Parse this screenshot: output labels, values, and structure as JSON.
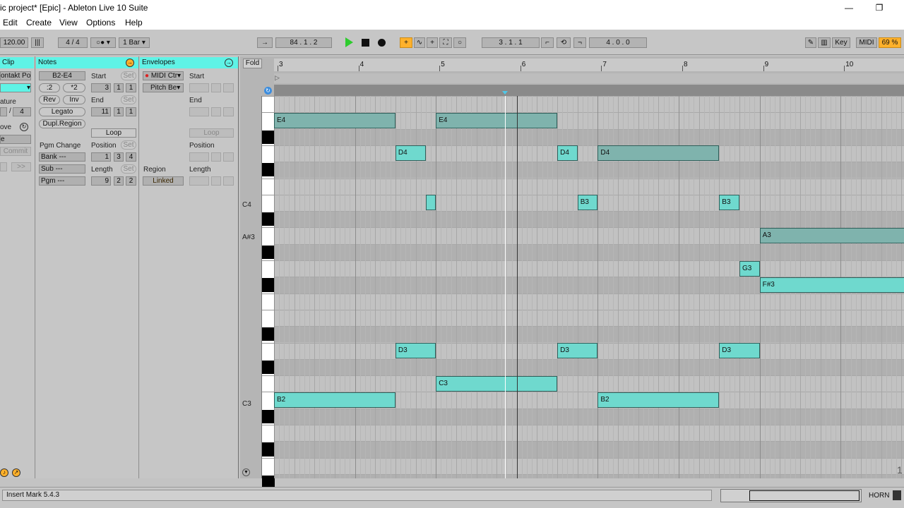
{
  "window": {
    "title": "ic project*  [Epic] - Ableton Live 10 Suite",
    "minimize": "—",
    "maximize": "❐"
  },
  "menu": [
    "Edit",
    "Create",
    "View",
    "Options",
    "Help"
  ],
  "control": {
    "tempo": "120.00",
    "signature_num": "4",
    "signature_sep": "/",
    "signature_den": "4",
    "quantize": "1 Bar",
    "arrangement_position": "84 .  1 .  2",
    "loop_start": "3 .  1 .  1",
    "loop_length": "4 .  0 .  0",
    "key_label": "Key",
    "midi_label": "MIDI",
    "cpu": "69 %"
  },
  "clip_pane": {
    "title": "Clip",
    "name": "ontakt Por",
    "signature_label": "ature",
    "signature_den": "4",
    "groove_label": "ove",
    "field_e": "e",
    "commit": "Commit",
    "nav_next": ">>"
  },
  "notes_pane": {
    "title": "Notes",
    "range": "B2-E4",
    "half": ":2",
    "double": "*2",
    "rev": "Rev",
    "inv": "Inv",
    "legato": "Legato",
    "dupl_region": "Dupl.Region",
    "pgm_change": "Pgm Change",
    "bank": "Bank ---",
    "sub": "Sub ---",
    "pgm": "Pgm ---",
    "start_label": "Start",
    "set": "Set",
    "start": [
      "3",
      "1",
      "1"
    ],
    "end_label": "End",
    "end": [
      "11",
      "1",
      "1"
    ],
    "loop": "Loop",
    "position_label": "Position",
    "position": [
      "1",
      "3",
      "4"
    ],
    "length_label": "Length",
    "length": [
      "9",
      "2",
      "2"
    ]
  },
  "env_pane": {
    "title": "Envelopes",
    "device": "MIDI Ctr",
    "control": "Pitch Be",
    "region_label": "Region",
    "linked": "Linked",
    "start_label": "Start",
    "end_label": "End",
    "loop": "Loop",
    "position_label": "Position",
    "length_label": "Length"
  },
  "editor": {
    "fold": "Fold",
    "ruler": [
      "3",
      "4",
      "5",
      "6",
      "7",
      "8",
      "9",
      "10"
    ],
    "key_labels": {
      "c4": "C4",
      "as3": "A#3",
      "c3": "C3"
    },
    "notes": [
      {
        "pitch": "E4",
        "label": "E4",
        "start": 3.0,
        "end": 4.5,
        "selected": false
      },
      {
        "pitch": "E4",
        "label": "E4",
        "start": 5.0,
        "end": 6.5,
        "selected": false
      },
      {
        "pitch": "D4",
        "label": "D4",
        "start": 4.5,
        "end": 4.875,
        "selected": true
      },
      {
        "pitch": "D4",
        "label": "D4",
        "start": 6.5,
        "end": 6.75,
        "selected": true
      },
      {
        "pitch": "D4",
        "label": "D4",
        "start": 7.0,
        "end": 8.5,
        "selected": false
      },
      {
        "pitch": "B3",
        "label": "",
        "start": 4.875,
        "end": 5.0,
        "selected": true
      },
      {
        "pitch": "B3",
        "label": "B3",
        "start": 6.75,
        "end": 7.0,
        "selected": true
      },
      {
        "pitch": "B3",
        "label": "B3",
        "start": 8.5,
        "end": 8.75,
        "selected": true
      },
      {
        "pitch": "A3",
        "label": "A3",
        "start": 9.0,
        "end": 11.0,
        "selected": false
      },
      {
        "pitch": "G3",
        "label": "G3",
        "start": 8.75,
        "end": 9.0,
        "selected": true
      },
      {
        "pitch": "F#3",
        "label": "F#3",
        "start": 9.0,
        "end": 11.0,
        "selected": true
      },
      {
        "pitch": "D3",
        "label": "D3",
        "start": 4.5,
        "end": 5.0,
        "selected": true
      },
      {
        "pitch": "D3",
        "label": "D3",
        "start": 6.5,
        "end": 7.0,
        "selected": true
      },
      {
        "pitch": "D3",
        "label": "D3",
        "start": 8.5,
        "end": 9.0,
        "selected": true
      },
      {
        "pitch": "C3",
        "label": "C3",
        "start": 5.0,
        "end": 6.5,
        "selected": true
      },
      {
        "pitch": "B2",
        "label": "B2",
        "start": 3.0,
        "end": 4.5,
        "selected": true
      },
      {
        "pitch": "B2",
        "label": "B2",
        "start": 7.0,
        "end": 8.5,
        "selected": true
      }
    ],
    "playhead_bar": 5.85,
    "clip_edge_bar": 6.0,
    "corner_number": "1"
  },
  "status": {
    "message": "Insert Mark 5.4.3",
    "track": "HORN"
  },
  "colors": {
    "selected_note": "#6fd9ce",
    "unselected_note": "#7fb3ad",
    "header_teal": "#5ff3e6",
    "accent_orange": "#ffb12b",
    "play_green": "#2ecc2e"
  }
}
